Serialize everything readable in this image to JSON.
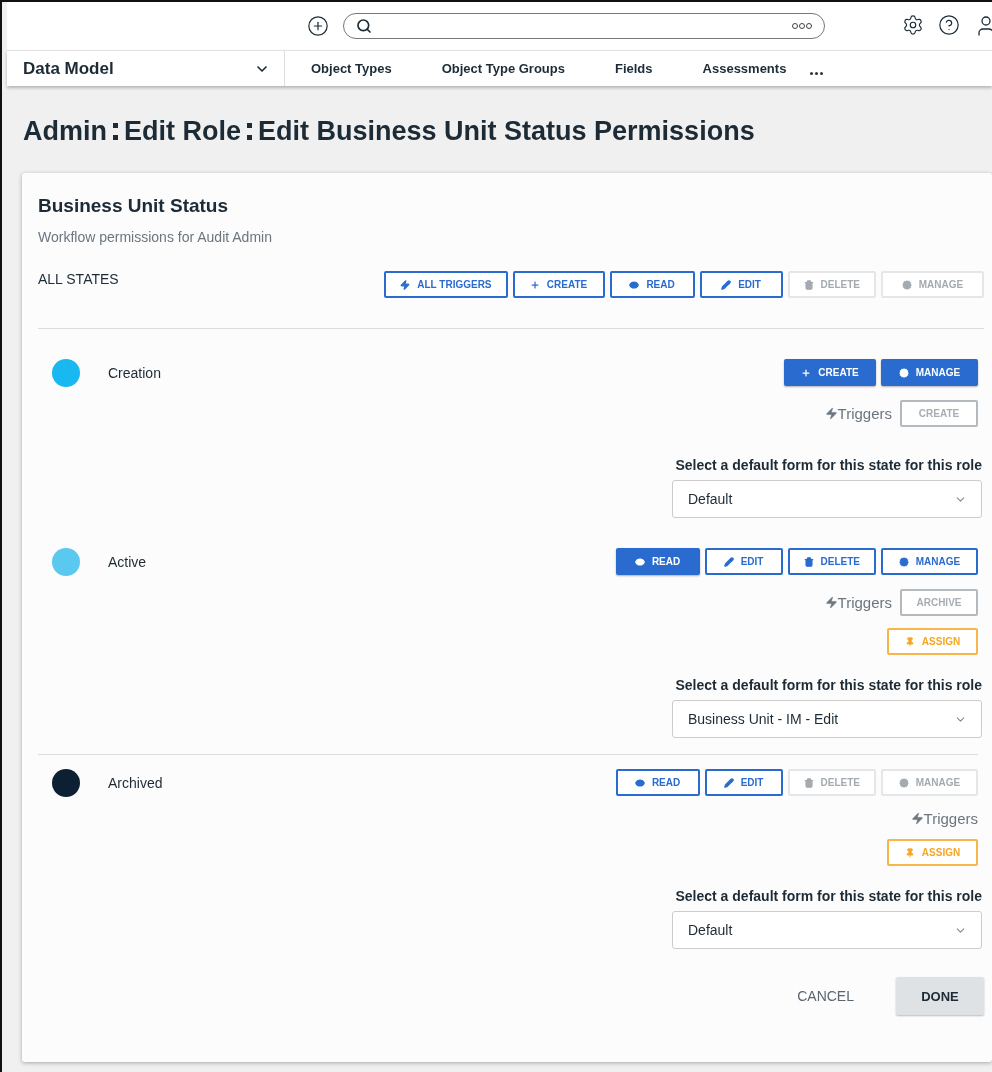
{
  "nav": {
    "module": "Data Model",
    "tabs": [
      {
        "label": "Object Types"
      },
      {
        "label": "Object Type Groups"
      },
      {
        "label": "Fields"
      },
      {
        "label": "Assessments"
      }
    ]
  },
  "page_title": {
    "parts": [
      "Admin",
      "Edit Role",
      "Edit Business Unit Status Permissions"
    ]
  },
  "card": {
    "title": "Business Unit Status",
    "subtitle": "Workflow permissions for Audit Admin",
    "all_states": {
      "label": "ALL STATES",
      "buttons": [
        {
          "label": "ALL TRIGGERS",
          "kind": "trigger",
          "disabled": false
        },
        {
          "label": "CREATE",
          "kind": "create",
          "disabled": false
        },
        {
          "label": "READ",
          "kind": "read",
          "disabled": false
        },
        {
          "label": "EDIT",
          "kind": "edit",
          "disabled": false
        },
        {
          "label": "DELETE",
          "kind": "delete",
          "disabled": true
        },
        {
          "label": "MANAGE",
          "kind": "manage",
          "disabled": true
        }
      ]
    },
    "states": [
      {
        "name": "Creation",
        "color": "#1ab8f0",
        "separated": false,
        "buttons": [
          {
            "label": "CREATE",
            "kind": "create",
            "selected": true,
            "disabled": false
          },
          {
            "label": "MANAGE",
            "kind": "manage",
            "selected": true,
            "disabled": false
          }
        ],
        "triggers_label": "Triggers",
        "triggers": [
          {
            "label": "CREATE"
          }
        ],
        "form_label": "Select a default form for this state for this role",
        "form_value": "Default"
      },
      {
        "name": "Active",
        "color": "#5bc8f0",
        "separated": false,
        "buttons": [
          {
            "label": "READ",
            "kind": "read",
            "selected": true,
            "disabled": false
          },
          {
            "label": "EDIT",
            "kind": "edit",
            "selected": false,
            "disabled": false
          },
          {
            "label": "DELETE",
            "kind": "delete",
            "selected": false,
            "disabled": false
          },
          {
            "label": "MANAGE",
            "kind": "manage",
            "selected": false,
            "disabled": false
          }
        ],
        "triggers_label": "Triggers",
        "triggers": [
          {
            "label": "ARCHIVE"
          }
        ],
        "assign": {
          "label": "ASSIGN"
        },
        "form_label": "Select a default form for this state for this role",
        "form_value": "Business Unit - IM - Edit"
      },
      {
        "name": "Archived",
        "color": "#0d1f33",
        "separated": true,
        "buttons": [
          {
            "label": "READ",
            "kind": "read",
            "selected": false,
            "disabled": false
          },
          {
            "label": "EDIT",
            "kind": "edit",
            "selected": false,
            "disabled": false
          },
          {
            "label": "DELETE",
            "kind": "delete",
            "selected": false,
            "disabled": true
          },
          {
            "label": "MANAGE",
            "kind": "manage",
            "selected": false,
            "disabled": true
          }
        ],
        "triggers_label": "Triggers",
        "assign": {
          "label": "ASSIGN"
        },
        "form_label": "Select a default form for this state for this role",
        "form_value": "Default"
      }
    ],
    "actions": {
      "cancel": "CANCEL",
      "done": "DONE"
    }
  }
}
